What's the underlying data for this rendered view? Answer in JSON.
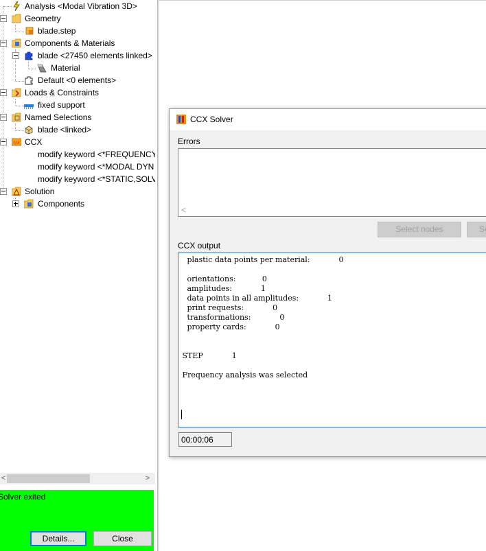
{
  "tree": {
    "nodes": [
      {
        "key": "analysis",
        "label": "Analysis <Modal Vibration 3D>"
      },
      {
        "key": "geometry",
        "label": "Geometry"
      },
      {
        "key": "blade_step",
        "label": "blade.step"
      },
      {
        "key": "components_materials",
        "label": "Components & Materials"
      },
      {
        "key": "blade_linked",
        "label": "blade <27450 elements linked>"
      },
      {
        "key": "material",
        "label": "Material"
      },
      {
        "key": "default",
        "label": "Default <0 elements>"
      },
      {
        "key": "loads",
        "label": "Loads & Constraints"
      },
      {
        "key": "fixed_support",
        "label": "fixed support"
      },
      {
        "key": "named_selections",
        "label": "Named Selections"
      },
      {
        "key": "blade_named",
        "label": "blade <linked>"
      },
      {
        "key": "ccx",
        "label": "CCX"
      },
      {
        "key": "kw_frequency",
        "label": "modify keyword <*FREQUENCY,"
      },
      {
        "key": "kw_modal",
        "label": "modify keyword <*MODAL DYN"
      },
      {
        "key": "kw_static",
        "label": "modify keyword <*STATIC,SOLV"
      },
      {
        "key": "solution",
        "label": "Solution"
      },
      {
        "key": "components",
        "label": "Components"
      }
    ]
  },
  "scrollbar": {
    "left_arrow": "<",
    "right_arrow": ">"
  },
  "status": {
    "text": "Solver exited",
    "background": "#00ff00",
    "details_label": "Details...",
    "close_label": "Close"
  },
  "dialog": {
    "title": "CCX Solver",
    "errors_label": "Errors",
    "errors_scroll_arrow": "<",
    "select_nodes_label": "Select nodes",
    "select_other_label": "Se",
    "output_label": "CCX output",
    "output_lines": [
      "   plastic data points per material:            0",
      "",
      "   orientations:           0",
      "   amplitudes:            1",
      "   data points in all amplitudes:            1",
      "   print requests:            0",
      "   transformations:            0",
      "   property cards:            0",
      "",
      "",
      " STEP            1",
      "",
      " Frequency analysis was selected"
    ],
    "timer": "00:00:06"
  }
}
